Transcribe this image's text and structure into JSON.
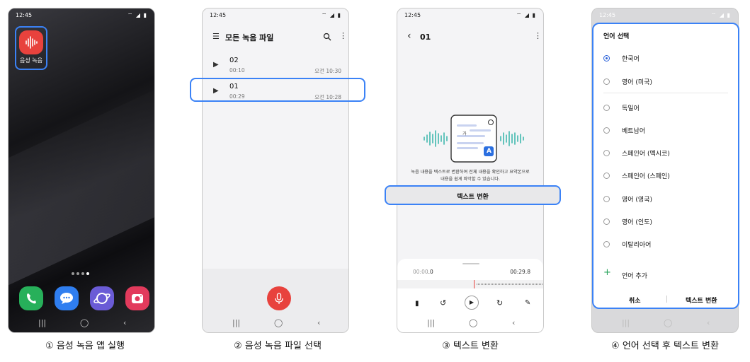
{
  "status_time": "12:45",
  "status_icons": "⌔ ◢ ▮",
  "captions": [
    "① 음성 녹음 앱 실행",
    "② 음성 녹음 파일 선택",
    "③ 텍스트 변환",
    "④ 언어 선택 후 텍스트 변환"
  ],
  "phone1": {
    "app_label": "음성 녹음",
    "dock": [
      "phone-icon",
      "messages-icon",
      "internet-icon",
      "camera-icon"
    ],
    "colors": {
      "recorder": "#e8423d",
      "phone": "#27b05a",
      "messages": "#2f7ef0",
      "internet": "#6a5bd6",
      "camera": "#e23a5c"
    }
  },
  "phone2": {
    "title": "모든 녹음 파일",
    "files": [
      {
        "name": "02",
        "duration": "00:10",
        "time": "오전 10:30"
      },
      {
        "name": "01",
        "duration": "00:29",
        "time": "오전 10:28"
      }
    ]
  },
  "phone3": {
    "title": "01",
    "desc_line1": "녹음 내용을 텍스트로 변환하여 전체 내용을 확인하고 요약본으로",
    "desc_line2": "내용을 쉽게 파악할 수 있습니다.",
    "convert_button": "텍스트 변환",
    "glyph_ga": "가",
    "glyph_a": "A",
    "time_start": "00:00",
    "time_start_suffix": ".0",
    "time_end": "00:29.8"
  },
  "phone4": {
    "title": "언어 선택",
    "languages": [
      {
        "label": "한국어",
        "selected": true
      },
      {
        "label": "영어 (미국)",
        "selected": false
      },
      {
        "label": "독일어",
        "selected": false
      },
      {
        "label": "베트남어",
        "selected": false
      },
      {
        "label": "스페인어 (멕시코)",
        "selected": false
      },
      {
        "label": "스페인어 (스페인)",
        "selected": false
      },
      {
        "label": "영어 (영국)",
        "selected": false
      },
      {
        "label": "영어 (인도)",
        "selected": false
      },
      {
        "label": "이탈리아어",
        "selected": false
      }
    ],
    "add_language": "언어 추가",
    "cancel": "취소",
    "convert": "텍스트 변환"
  }
}
